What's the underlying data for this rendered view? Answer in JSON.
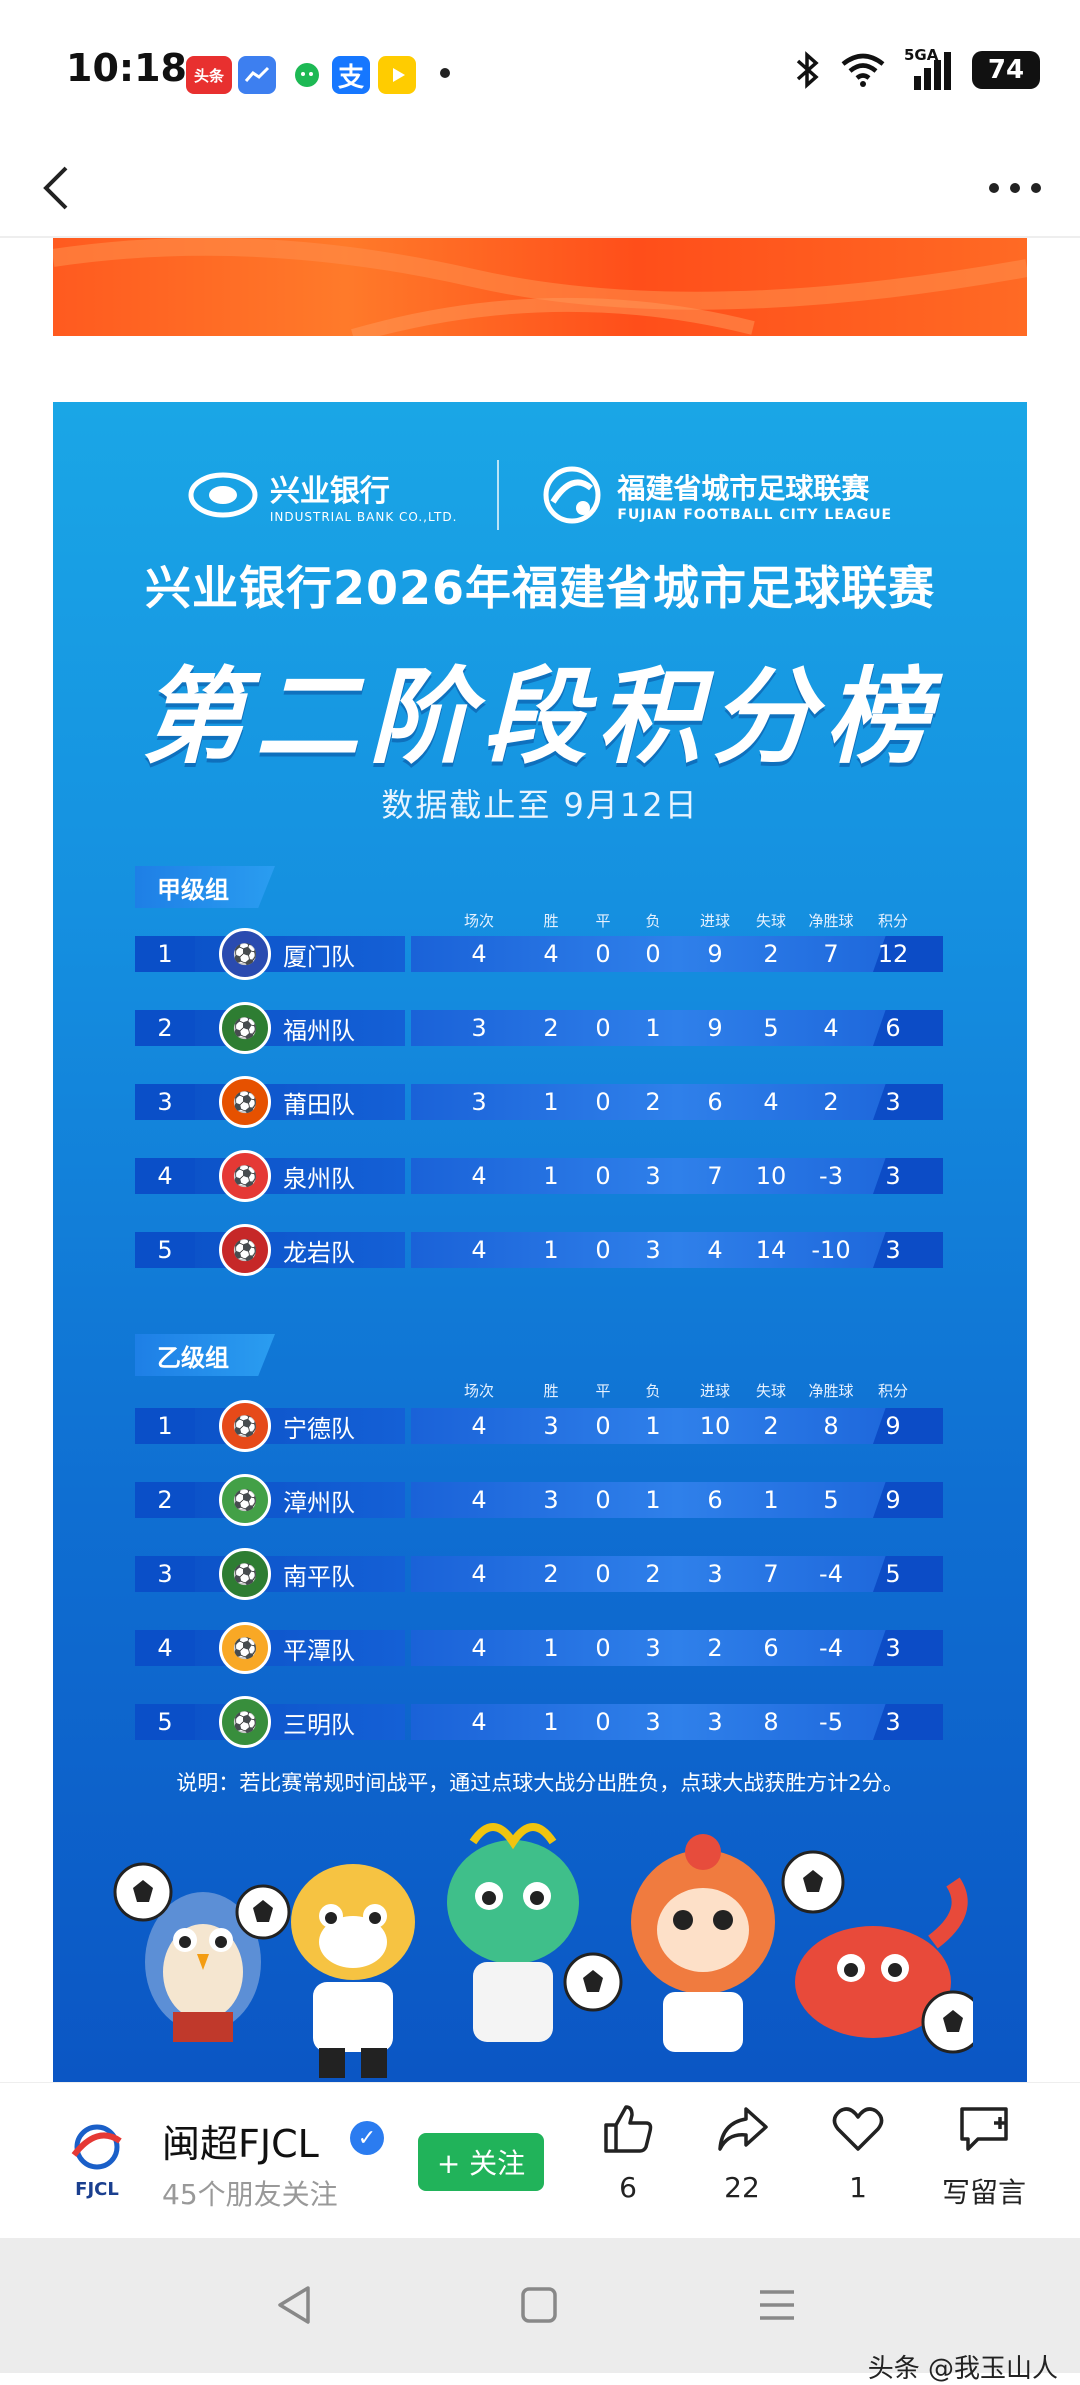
{
  "status_bar": {
    "time": "10:18",
    "notifications": [
      {
        "icon": "toutiao-icon",
        "label": "头条",
        "color": "#e8302f"
      },
      {
        "icon": "stock-app-icon",
        "label": "",
        "color": "#3d7ff0"
      },
      {
        "icon": "wechat-icon",
        "label": "",
        "color": "#1db954"
      },
      {
        "icon": "alipay-icon",
        "label": "支",
        "color": "#1677ff"
      },
      {
        "icon": "video-app-icon",
        "label": "",
        "color": "#ffcc00"
      }
    ],
    "network": "5GA",
    "battery": "74"
  },
  "poster": {
    "sponsor": {
      "name": "兴业银行",
      "sub": "INDUSTRIAL BANK CO.,LTD."
    },
    "league": {
      "name": "福建省城市足球联赛",
      "sub": "FUJIAN FOOTBALL CITY LEAGUE"
    },
    "title": "兴业银行2026年福建省城市足球联赛",
    "stage_title": "第二阶段积分榜",
    "cutoff": "数据截止至 9月12日",
    "columns": [
      "场次",
      "胜",
      "平",
      "负",
      "进球",
      "失球",
      "净胜球",
      "积分"
    ],
    "groups": [
      {
        "name": "甲级组",
        "teams": [
          {
            "rank": "1",
            "name": "厦门队",
            "played": "4",
            "won": "4",
            "drawn": "0",
            "lost": "0",
            "gf": "9",
            "ga": "2",
            "gd": "7",
            "pts": "12",
            "logo_color": "#2a4bb0"
          },
          {
            "rank": "2",
            "name": "福州队",
            "played": "3",
            "won": "2",
            "drawn": "0",
            "lost": "1",
            "gf": "9",
            "ga": "5",
            "gd": "4",
            "pts": "6",
            "logo_color": "#2e7d32"
          },
          {
            "rank": "3",
            "name": "莆田队",
            "played": "3",
            "won": "1",
            "drawn": "0",
            "lost": "2",
            "gf": "6",
            "ga": "4",
            "gd": "2",
            "pts": "3",
            "logo_color": "#e65100"
          },
          {
            "rank": "4",
            "name": "泉州队",
            "played": "4",
            "won": "1",
            "drawn": "0",
            "lost": "3",
            "gf": "7",
            "ga": "10",
            "gd": "-3",
            "pts": "3",
            "logo_color": "#e53935"
          },
          {
            "rank": "5",
            "name": "龙岩队",
            "played": "4",
            "won": "1",
            "drawn": "0",
            "lost": "3",
            "gf": "4",
            "ga": "14",
            "gd": "-10",
            "pts": "3",
            "logo_color": "#c62828"
          }
        ]
      },
      {
        "name": "乙级组",
        "teams": [
          {
            "rank": "1",
            "name": "宁德队",
            "played": "4",
            "won": "3",
            "drawn": "0",
            "lost": "1",
            "gf": "10",
            "ga": "2",
            "gd": "8",
            "pts": "9",
            "logo_color": "#e64a19"
          },
          {
            "rank": "2",
            "name": "漳州队",
            "played": "4",
            "won": "3",
            "drawn": "0",
            "lost": "1",
            "gf": "6",
            "ga": "1",
            "gd": "5",
            "pts": "9",
            "logo_color": "#43a047"
          },
          {
            "rank": "3",
            "name": "南平队",
            "played": "4",
            "won": "2",
            "drawn": "0",
            "lost": "2",
            "gf": "3",
            "ga": "7",
            "gd": "-4",
            "pts": "5",
            "logo_color": "#2e7d32"
          },
          {
            "rank": "4",
            "name": "平潭队",
            "played": "4",
            "won": "1",
            "drawn": "0",
            "lost": "3",
            "gf": "2",
            "ga": "6",
            "gd": "-4",
            "pts": "3",
            "logo_color": "#f9a825"
          },
          {
            "rank": "5",
            "name": "三明队",
            "played": "4",
            "won": "1",
            "drawn": "0",
            "lost": "3",
            "gf": "3",
            "ga": "8",
            "gd": "-5",
            "pts": "3",
            "logo_color": "#388e3c"
          }
        ]
      }
    ],
    "footnote": "说明：若比赛常规时间战平，通过点球大战分出胜负，点球大战获胜方计2分。"
  },
  "account": {
    "logo_text": "FJCL",
    "name": "闽超FJCL",
    "followers": "45个朋友关注",
    "follow_label": "+ 关注"
  },
  "actions": {
    "like_count": "6",
    "share_count": "22",
    "favorite_count": "1",
    "comment_label": "写留言"
  },
  "watermark": "头条 @我玉山人"
}
